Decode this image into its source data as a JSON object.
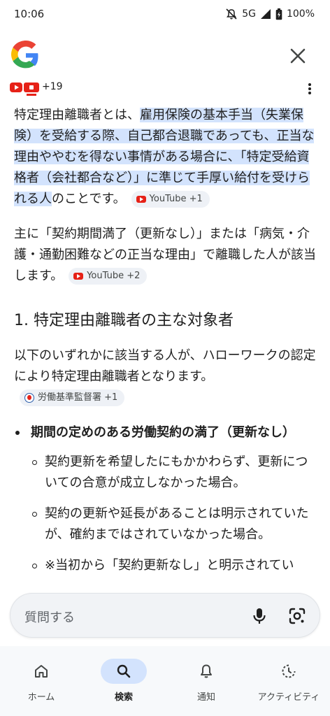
{
  "status": {
    "time": "10:06",
    "network": "5G",
    "battery": "100%"
  },
  "header": {
    "app": "Google"
  },
  "sources": {
    "count_label": "+19"
  },
  "body": {
    "p1": {
      "pre": "特定理由離職者とは、",
      "highlight": "雇用保険の基本手当（失業保険）を受給する際、自己都合退職であっても、正当な理由ややむを得ない事情がある場合に、「特定受給資格者（会社都合など）」に準じて手厚い給付を受けられる人",
      "post": "のことです。",
      "chip": "YouTube +1"
    },
    "p2": {
      "text": "主に「契約期間満了（更新なし）」または「病気・介護・通勤困難などの正当な理由」で離職した人が該当します。",
      "chip": "YouTube +2"
    },
    "heading": "1. 特定理由離職者の主な対象者",
    "p3": {
      "text": "以下のいずれかに該当する人が、ハローワークの認定により特定理由離職者となります。",
      "chip": "労働基準監督署 +1"
    },
    "bullet1": {
      "title": "期間の定めのある労働契約の満了（更新なし）",
      "subs": [
        "契約更新を希望したにもかかわらず、更新についての合意が成立しなかった場合。",
        "契約の更新や延長があることは明示されていたが、確約まではされていなかった場合。",
        "※当初から「契約更新なし」と明示されてい"
      ]
    }
  },
  "search": {
    "placeholder": "質問する"
  },
  "nav": {
    "home": "ホーム",
    "search": "検索",
    "notifications": "通知",
    "activity": "アクティビティ"
  },
  "colors": {
    "highlight": "#d3e3fd",
    "youtube_red": "#e62117",
    "active_nav": "#d3e3fd"
  }
}
